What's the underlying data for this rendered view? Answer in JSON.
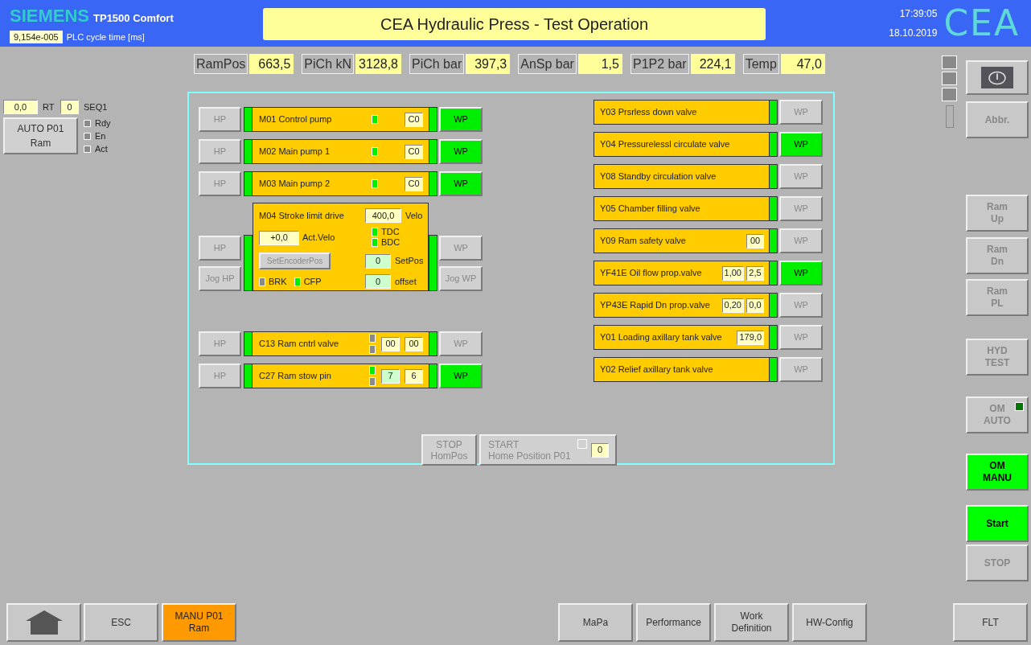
{
  "header": {
    "brand": "SIEMENS",
    "model": "TP1500 Comfort",
    "cycle_time": "9,154e-005",
    "cycle_time_label": "PLC cycle time [ms]",
    "title": "CEA Hydraulic Press - Test Operation",
    "time": "17:39:05",
    "date": "18.10.2019",
    "logo": "CEA"
  },
  "readings": [
    {
      "label": "RamPos",
      "value": "663,5"
    },
    {
      "label": "PiCh kN",
      "value": "3128,8"
    },
    {
      "label": "PiCh bar",
      "value": "397,3"
    },
    {
      "label": "AnSp bar",
      "value": "1,5"
    },
    {
      "label": "P1P2 bar",
      "value": "224,1"
    },
    {
      "label": "Temp",
      "value": "47,0"
    }
  ],
  "sequence": {
    "rt_value": "0,0",
    "rt_label": "RT",
    "seq_value": "0",
    "seq_label": "SEQ1",
    "button": [
      "AUTO P01",
      "Ram"
    ],
    "flags": [
      {
        "label": "Rdy",
        "checked": false
      },
      {
        "label": "En",
        "checked": false
      },
      {
        "label": "Act",
        "checked": false
      }
    ]
  },
  "drives": [
    {
      "kind": "motor",
      "name": "M01 Control pump",
      "left_buttons": [
        {
          "label": "HP",
          "active": false
        }
      ],
      "right_buttons": [
        {
          "label": "WP",
          "active": true
        }
      ],
      "leds": [
        true
      ],
      "fields": [
        {
          "value": "C0",
          "kind": "display"
        }
      ]
    },
    {
      "kind": "motor",
      "name": "M02 Main pump 1",
      "left_buttons": [
        {
          "label": "HP",
          "active": false
        }
      ],
      "right_buttons": [
        {
          "label": "WP",
          "active": true
        }
      ],
      "leds": [
        true
      ],
      "fields": [
        {
          "value": "C0",
          "kind": "display"
        }
      ]
    },
    {
      "kind": "motor",
      "name": "M03 Main pump 2",
      "left_buttons": [
        {
          "label": "HP",
          "active": false
        }
      ],
      "right_buttons": [
        {
          "label": "WP",
          "active": true
        }
      ],
      "leds": [
        true
      ],
      "fields": [
        {
          "value": "C0",
          "kind": "display"
        }
      ]
    },
    {
      "kind": "stroke",
      "name": "M04 Stroke limit drive",
      "left_buttons": [
        {
          "label": "HP",
          "active": false
        },
        {
          "label": "Jog HP",
          "active": false
        }
      ],
      "right_buttons": [
        {
          "label": "WP",
          "active": false
        },
        {
          "label": "Jog WP",
          "active": false
        }
      ],
      "velo": {
        "value": "400,0",
        "label": "Velo"
      },
      "act_velo": {
        "value": "+0,0",
        "label": "Act.Velo"
      },
      "limits": [
        {
          "label": "TDC",
          "on": true
        },
        {
          "label": "BDC",
          "on": true
        }
      ],
      "encoder_button": {
        "label": "SetEncoderPos",
        "disabled": true
      },
      "setpos": {
        "value": "0",
        "label": "SetPos"
      },
      "offset": {
        "value": "0",
        "label": "offset"
      },
      "status": [
        {
          "label": "BRK",
          "on": false
        },
        {
          "label": "CFP",
          "on": true
        }
      ]
    },
    {
      "kind": "motor",
      "name": "C13 Ram cntrl valve",
      "left_buttons": [
        {
          "label": "HP",
          "active": false
        }
      ],
      "right_buttons": [
        {
          "label": "WP",
          "active": false
        }
      ],
      "leds": [
        false,
        false
      ],
      "fields": [
        {
          "value": "00",
          "kind": "display"
        },
        {
          "value": "00",
          "kind": "display"
        }
      ]
    },
    {
      "kind": "motor",
      "name": "C27 Ram stow pin",
      "left_buttons": [
        {
          "label": "HP",
          "active": false
        }
      ],
      "right_buttons": [
        {
          "label": "WP",
          "active": true
        }
      ],
      "leds": [
        true,
        false
      ],
      "fields": [
        {
          "value": "7",
          "kind": "input"
        },
        {
          "value": "6",
          "kind": "display"
        }
      ]
    }
  ],
  "valves": [
    {
      "name": "Y03 Prsrless down valve",
      "wp": {
        "label": "WP",
        "active": false
      }
    },
    {
      "name": "Y04 Pressurelessl circulate valve",
      "wp": {
        "label": "WP",
        "active": true
      }
    },
    {
      "name": "Y08 Standby circulation valve",
      "wp": {
        "label": "WP",
        "active": false
      }
    },
    {
      "name": "Y05 Chamber filling valve",
      "wp": {
        "label": "WP",
        "active": false
      }
    },
    {
      "name": "Y09 Ram safety valve",
      "fields": [
        "00"
      ],
      "wp": {
        "label": "WP",
        "active": false
      }
    },
    {
      "name": "YF41E Oil flow prop.valve",
      "fields": [
        "1,00",
        "2,5"
      ],
      "wp": {
        "label": "WP",
        "active": true
      }
    },
    {
      "name": "YP43E Rapid Dn prop.valve",
      "fields": [
        "0,20",
        "0,0"
      ],
      "wp": {
        "label": "WP",
        "active": false
      }
    },
    {
      "name": "Y01 Loading axillary tank valve",
      "fields": [
        "179,0"
      ],
      "wp": {
        "label": "WP",
        "active": false
      }
    },
    {
      "name": "Y02 Relief axillary tank valve",
      "wp": {
        "label": "WP",
        "active": false
      }
    }
  ],
  "homing": {
    "stop": [
      "STOP",
      "HomPos"
    ],
    "start": [
      "START",
      "Home Position P01"
    ],
    "start_checked": false,
    "counter": "0"
  },
  "side_buttons": [
    {
      "kind": "power",
      "active": false
    },
    {
      "kind": "text",
      "lines": [
        "Abbr."
      ],
      "active": false
    },
    {
      "kind": "text",
      "lines": [
        "Ram",
        "Up"
      ],
      "active": false
    },
    {
      "kind": "text",
      "lines": [
        "Ram",
        "Dn"
      ],
      "active": false
    },
    {
      "kind": "text",
      "lines": [
        "Ram",
        "PL"
      ],
      "active": false
    },
    {
      "kind": "text",
      "lines": [
        "HYD",
        "TEST"
      ],
      "active": false
    },
    {
      "kind": "lamp",
      "lines": [
        "OM",
        "AUTO"
      ],
      "active": false,
      "lamp": false
    },
    {
      "kind": "text",
      "lines": [
        "OM",
        "MANU"
      ],
      "active": true
    },
    {
      "kind": "text",
      "lines": [
        "Start"
      ],
      "active": true
    },
    {
      "kind": "text",
      "lines": [
        "STOP"
      ],
      "active": false
    }
  ],
  "nav": [
    {
      "kind": "home",
      "selected": false
    },
    {
      "kind": "text",
      "lines": [
        "ESC"
      ],
      "selected": false
    },
    {
      "kind": "text",
      "lines": [
        "MANU P01",
        "Ram"
      ],
      "selected": true
    },
    {
      "kind": "text",
      "lines": [
        "MaPa"
      ],
      "selected": false
    },
    {
      "kind": "text",
      "lines": [
        "Performance"
      ],
      "selected": false
    },
    {
      "kind": "text",
      "lines": [
        "Work",
        "Definition"
      ],
      "selected": false
    },
    {
      "kind": "text",
      "lines": [
        "HW-Config"
      ],
      "selected": false
    },
    {
      "kind": "text",
      "lines": [
        "FLT"
      ],
      "selected": false
    }
  ]
}
